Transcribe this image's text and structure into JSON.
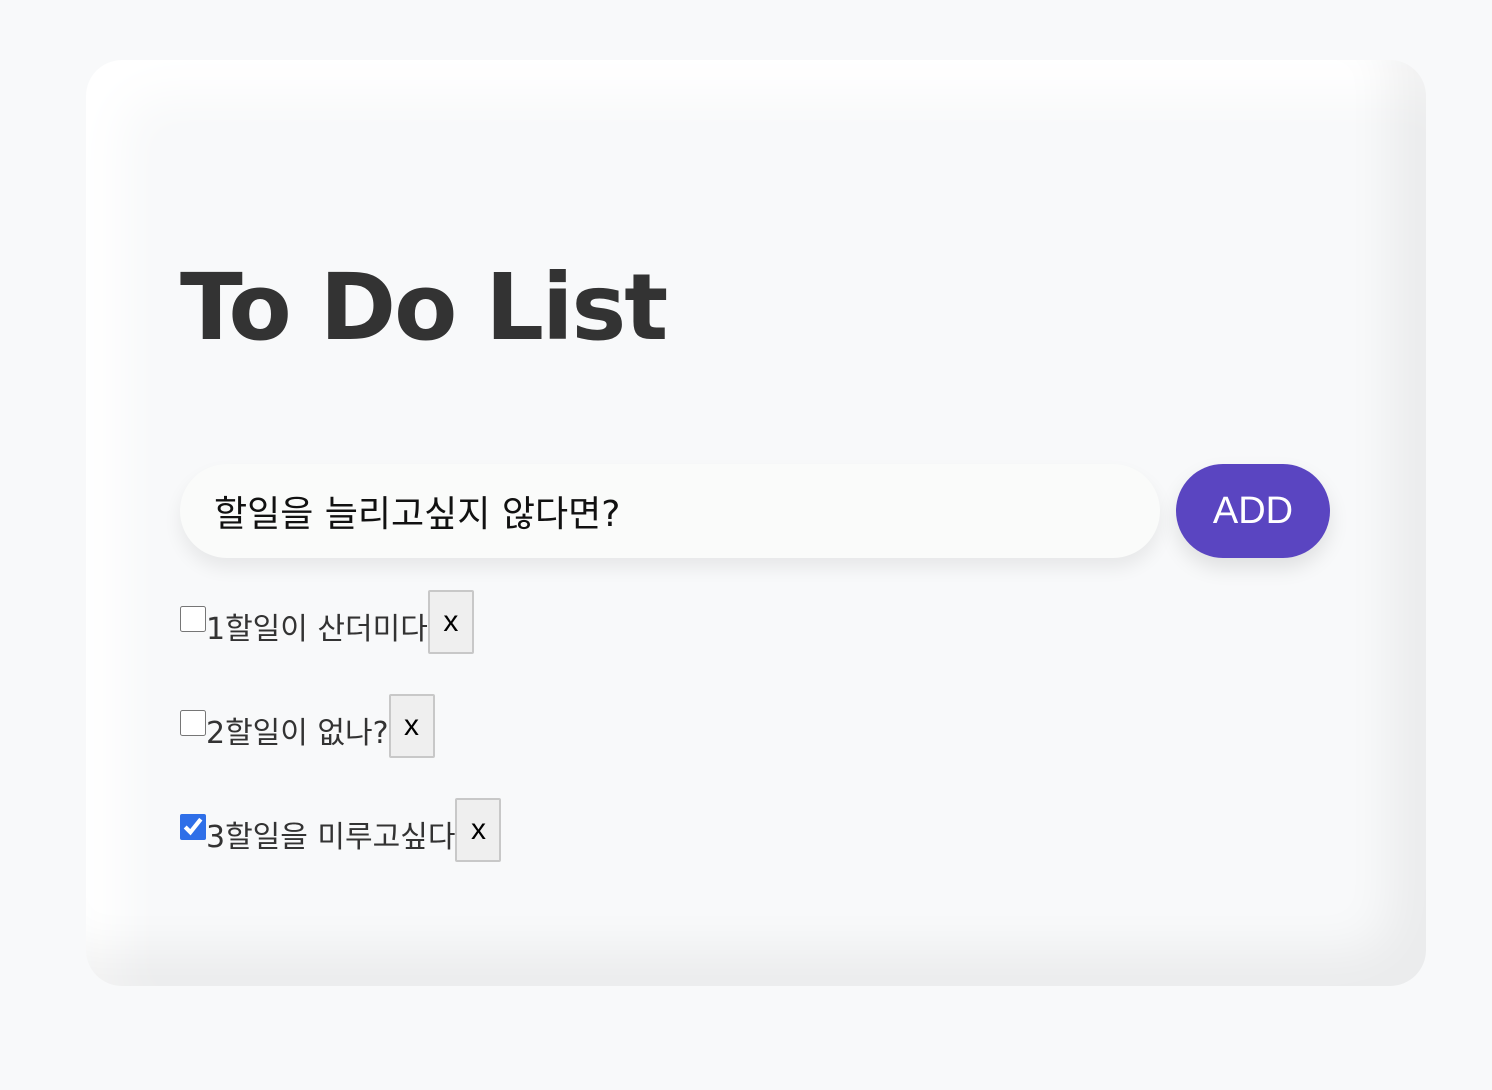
{
  "app": {
    "title": "To Do List"
  },
  "form": {
    "input_value": "할일을 늘리고싶지 않다면?",
    "add_label": "ADD"
  },
  "todos": [
    {
      "text": "1할일이 산더미다",
      "checked": false,
      "delete_label": "x"
    },
    {
      "text": "2할일이 없나?",
      "checked": false,
      "delete_label": "x"
    },
    {
      "text": "3할일을 미루고싶다",
      "checked": true,
      "delete_label": "x"
    }
  ],
  "colors": {
    "background": "#f8f9fa",
    "title": "#333333",
    "accent": "#5a45c1",
    "checkbox": "#2f6fe8"
  }
}
